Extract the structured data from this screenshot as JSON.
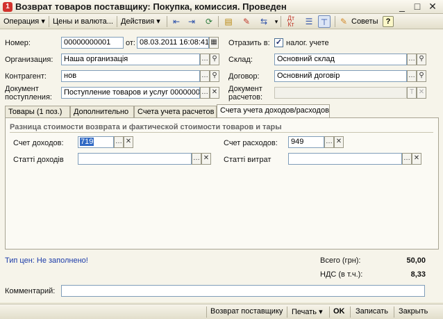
{
  "window": {
    "title": "Возврат товаров поставщику: Покупка, комиссия. Проведен",
    "minimize": "_",
    "maximize": "□",
    "close": "✕"
  },
  "toolbar": {
    "operation": "Операция ▾",
    "prices": "Цены и валюта...",
    "actions": "Действия ▾",
    "tips": "Советы",
    "help": "?"
  },
  "header": {
    "number_label": "Номер:",
    "number_value": "00000000001",
    "date_label": "от:",
    "date_value": "08.03.2011 16:08:41",
    "reflect_label": "Отразить в:",
    "tax_label": "налог. учете",
    "tax_checked": "✓",
    "org_label": "Организация:",
    "org_value": "Наша организація",
    "warehouse_label": "Склад:",
    "warehouse_value": "Основний склад",
    "contractor_label": "Контрагент:",
    "contractor_value": "нов",
    "contract_label": "Договор:",
    "contract_value": "Основний договір",
    "receipt_doc_label_1": "Документ",
    "receipt_doc_label_2": "поступления:",
    "receipt_doc_value": "Поступление товаров и услуг 0000000",
    "settle_doc_label_1": "Документ",
    "settle_doc_label_2": "расчетов:",
    "settle_doc_value": ""
  },
  "tabs": [
    {
      "label": "Товары (1 поз.)"
    },
    {
      "label": "Дополнительно"
    },
    {
      "label": "Счета учета расчетов"
    },
    {
      "label": "Счета учета доходов/расходов"
    }
  ],
  "panel": {
    "group_title": "Разница стоимости возврата и фактической стоимости товаров и тары",
    "income_account_label": "Счет доходов:",
    "income_account_value": "719",
    "expense_account_label": "Счет расходов:",
    "expense_account_value": "949",
    "income_items_label": "Статті доходів",
    "income_items_value": "",
    "expense_items_label": "Статті витрат",
    "expense_items_value": ""
  },
  "footer": {
    "price_type": "Тип цен: Не заполнено!",
    "total_label": "Всего (грн):",
    "total_value": "50,00",
    "vat_label": "НДС (в т.ч.):",
    "vat_value": "8,33",
    "comment_label": "Комментарий:",
    "comment_value": ""
  },
  "bottom": {
    "return_supplier": "Возврат поставщику",
    "print": "Печать ▾",
    "ok": "OK",
    "save": "Записать",
    "close": "Закрыть"
  },
  "colors": {
    "accent": "#316ac5",
    "link": "#1a3aa8",
    "background": "#ece9d8"
  }
}
